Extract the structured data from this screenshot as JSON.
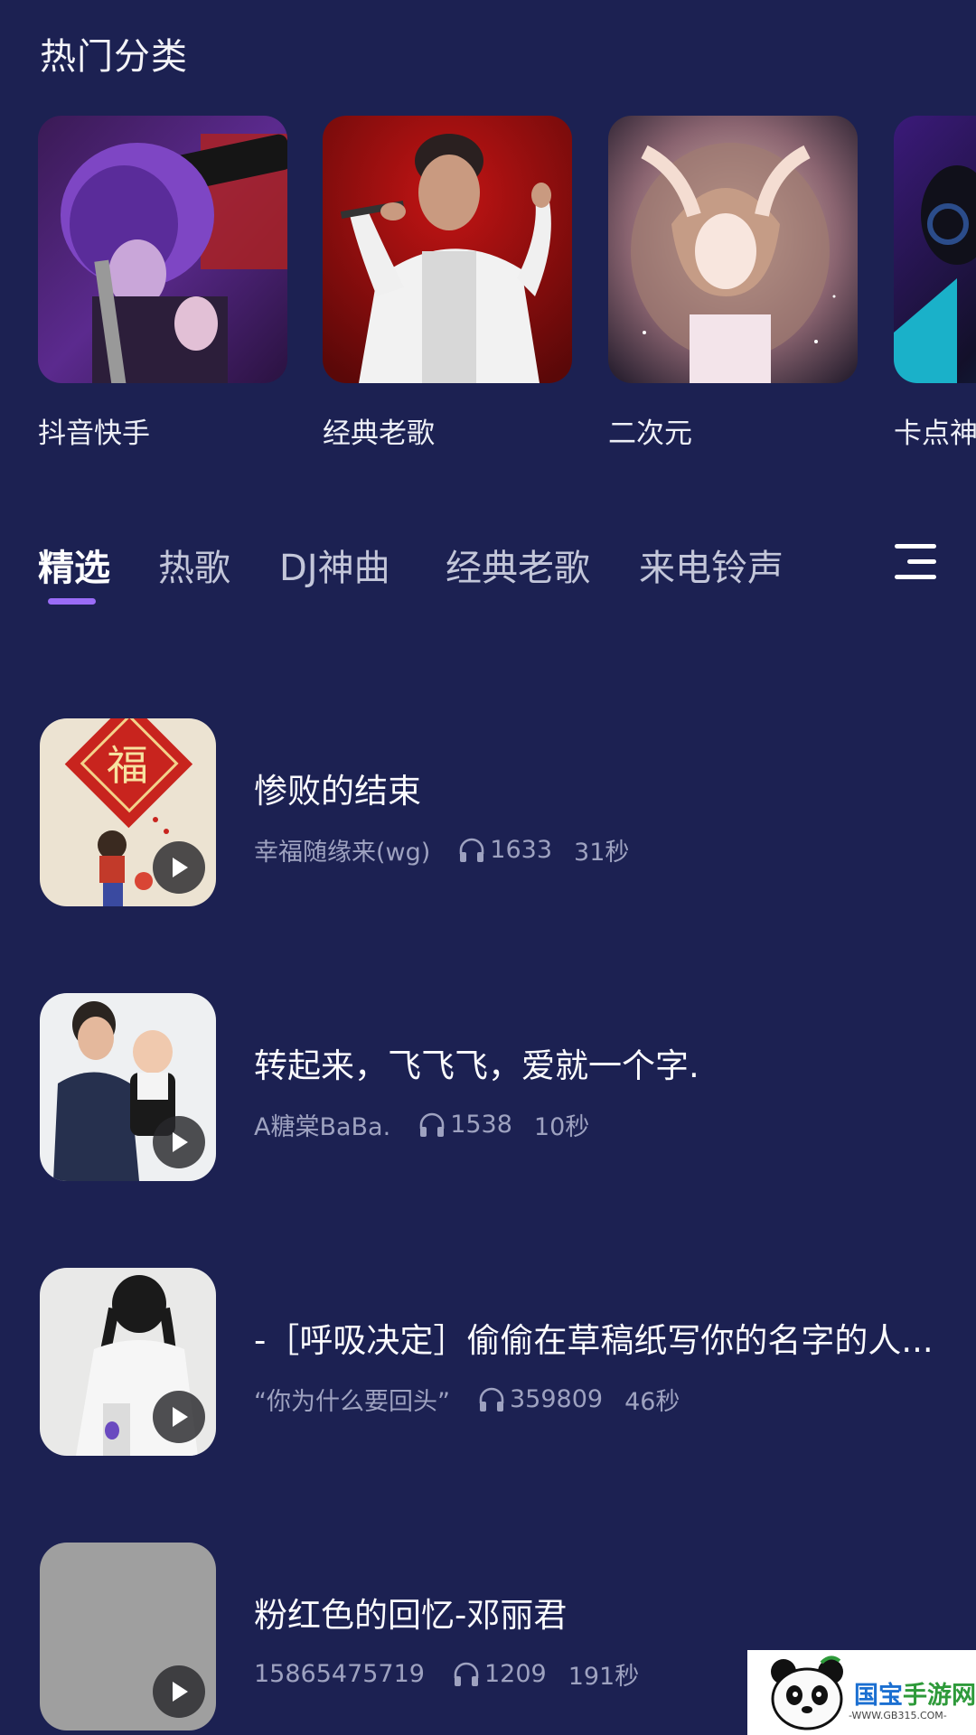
{
  "section": {
    "title": "热门分类"
  },
  "categories": [
    {
      "label": "抖音快手"
    },
    {
      "label": "经典老歌"
    },
    {
      "label": "二次元"
    },
    {
      "label": "卡点神"
    }
  ],
  "tabs": [
    {
      "label": "精选",
      "active": true
    },
    {
      "label": "热歌"
    },
    {
      "label": "DJ神曲"
    },
    {
      "label": "经典老歌"
    },
    {
      "label": "来电铃声"
    }
  ],
  "songs": [
    {
      "title": "惨败的结束",
      "author": "幸福随缘来(wg)",
      "plays": "1633",
      "duration": "31秒"
    },
    {
      "title": "转起来，飞飞飞，爱就一个字.",
      "author": "A糖棠BaBa.",
      "plays": "1538",
      "duration": "10秒"
    },
    {
      "title": "-［呼吸决定］偷偷在草稿纸写你的名字的人...",
      "author": "“你为什么要回头”",
      "plays": "359809",
      "duration": "46秒"
    },
    {
      "title": "粉红色的回忆-邓丽君",
      "author": "15865475719",
      "plays": "1209",
      "duration": "191秒"
    }
  ],
  "thumb_text": {
    "fu": "福"
  },
  "watermark": {
    "brand_a": "国宝",
    "brand_b": "手游网",
    "domain": "-WWW.GB315.COM-"
  },
  "colors": {
    "background": "#1c2152",
    "accent": "#9a6cf7",
    "meta": "#9ea2c0"
  }
}
